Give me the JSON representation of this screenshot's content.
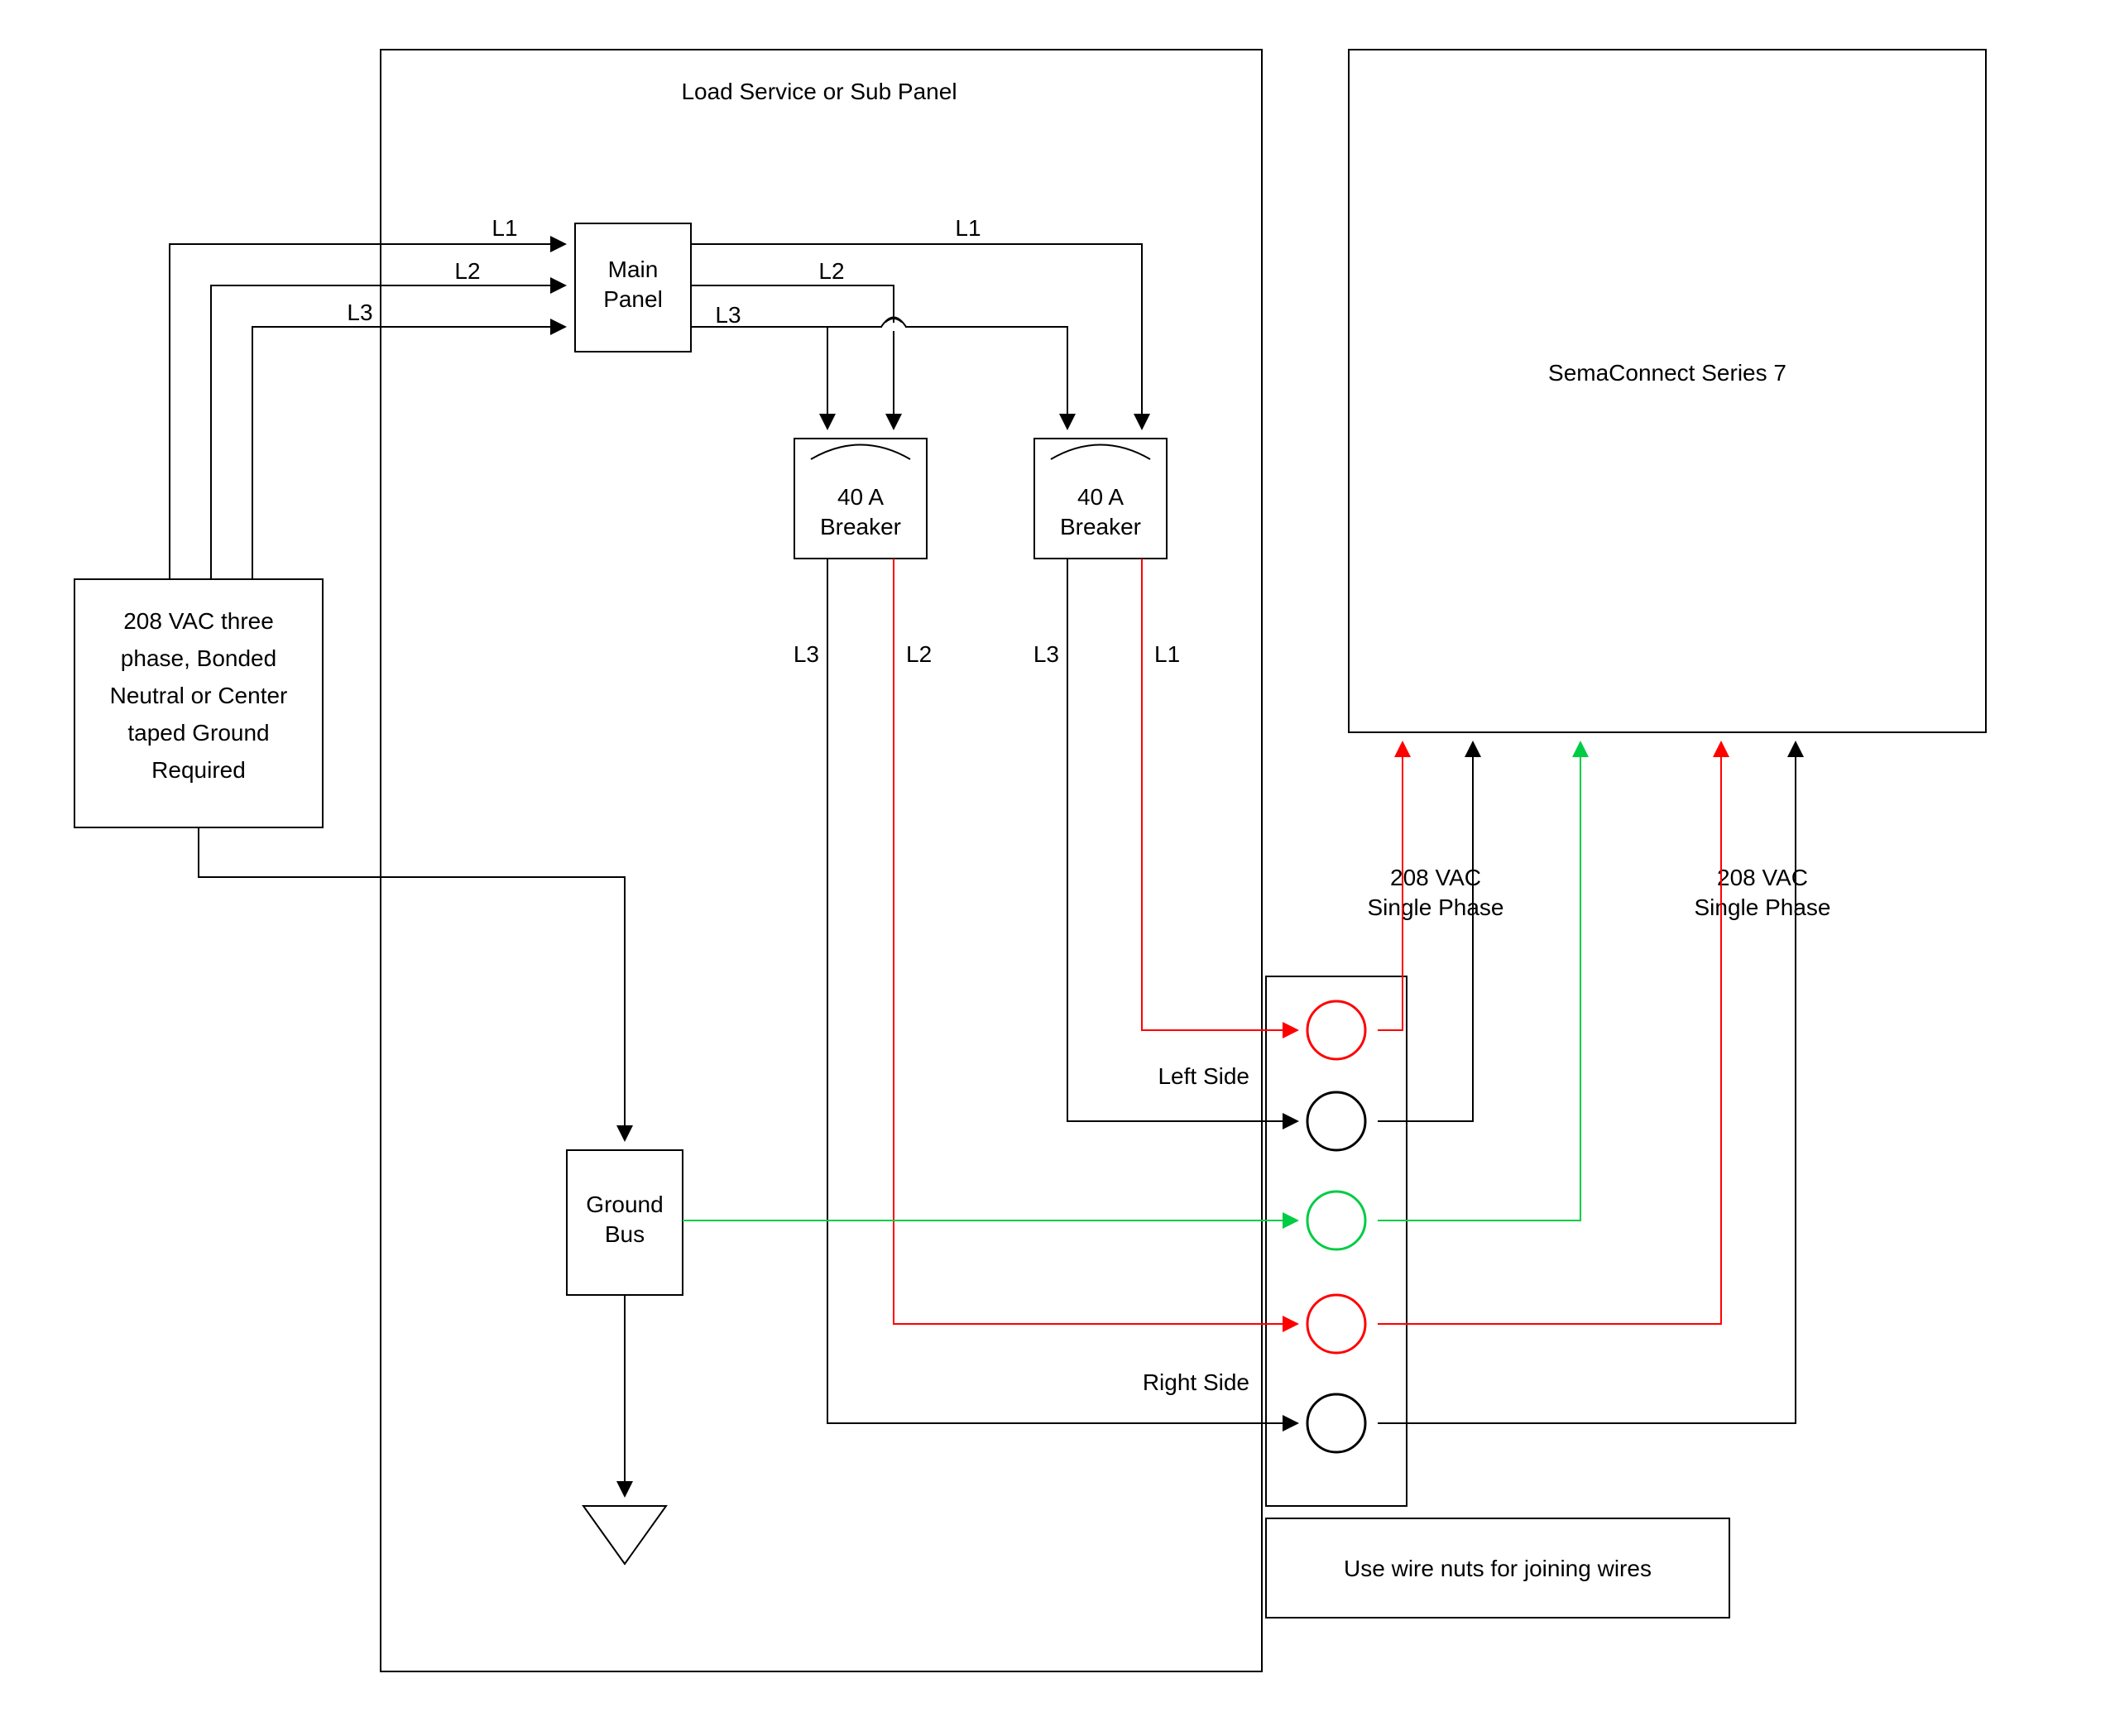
{
  "panel": {
    "title": "Load Service or Sub Panel",
    "main": "Main\nPanel",
    "breaker1": "40 A\nBreaker",
    "breaker2": "40 A\nBreaker",
    "ground": "Ground\nBus",
    "left_side": "Left Side",
    "right_side": "Right Side",
    "wire_nuts": "Use wire nuts for joining wires"
  },
  "source": {
    "label": "208 VAC three\nphase, Bonded\nNeutral or Center\ntaped Ground\nRequired"
  },
  "device": {
    "title": "SemaConnect Series 7",
    "phase1": "208 VAC\nSingle Phase",
    "phase2": "208 VAC\nSingle Phase"
  },
  "lines": {
    "L1": "L1",
    "L2": "L2",
    "L3": "L3"
  },
  "colors": {
    "red": "#ff0000",
    "green": "#00cc44",
    "black": "#000000"
  }
}
